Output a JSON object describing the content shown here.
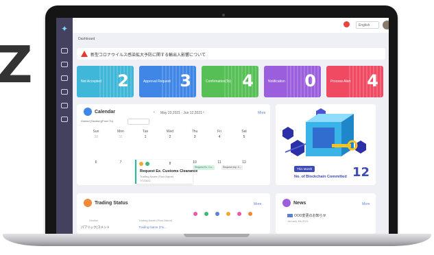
{
  "decor": {
    "big_letter": "Z"
  },
  "app": {
    "breadcrumb": "Dashboard",
    "language": "English",
    "sidebar_icons": [
      "logo-icon",
      "grid-icon",
      "document-icon",
      "swap-icon",
      "cloud-icon",
      "database-icon",
      "box-icon"
    ]
  },
  "alert": {
    "text": "新型コロナウイルス感染拡大予防に関する輸出入影響について"
  },
  "cards": [
    {
      "label": "Not Accepted",
      "value": "2",
      "color": "#3fb7d9"
    },
    {
      "label": "Approval Request",
      "value": "3",
      "color": "#3f86e6"
    },
    {
      "label": "Confirmation(To)",
      "value": "4",
      "color": "#56bf55"
    },
    {
      "label": "Notification",
      "value": "0",
      "color": "#9b5fde"
    },
    {
      "label": "Process Alert",
      "value": "4",
      "color": "#f04a62"
    }
  ],
  "calendar": {
    "title": "Calendar",
    "range": "May 23,2021 - Jun 12,2021",
    "filter_label": "Owned (Section)(From To)",
    "more": "More",
    "days": [
      "Sun",
      "Mon",
      "Tue",
      "Wed",
      "Thu",
      "Fri",
      "Sat"
    ],
    "week1": [
      "30",
      "31",
      "1",
      "2",
      "3",
      "4",
      "5"
    ],
    "week2": [
      "6",
      "7",
      "8",
      "9",
      "10",
      "11",
      "12"
    ],
    "event": {
      "title": "Request Ex. Customs Clearance",
      "sub": "Trading Name (Flow Name)",
      "date": "7/7/2021"
    },
    "chips": [
      "Request Ex. Cu...",
      "Request Imp. C..."
    ]
  },
  "blockchain": {
    "badge": "This Month",
    "label": "No. of Blockchain Committed",
    "value": "12"
  },
  "trading": {
    "title": "Trading Status",
    "more": "More",
    "col_section": "Section",
    "col_name": "Trading Name (Flow Name)",
    "row_section": "パブリック(コメント",
    "row_link": "Trading Name (Flo..."
  },
  "news": {
    "title": "News",
    "more": "More",
    "item": "OOO変更のお知らせ",
    "date": "January 4th,2021"
  }
}
